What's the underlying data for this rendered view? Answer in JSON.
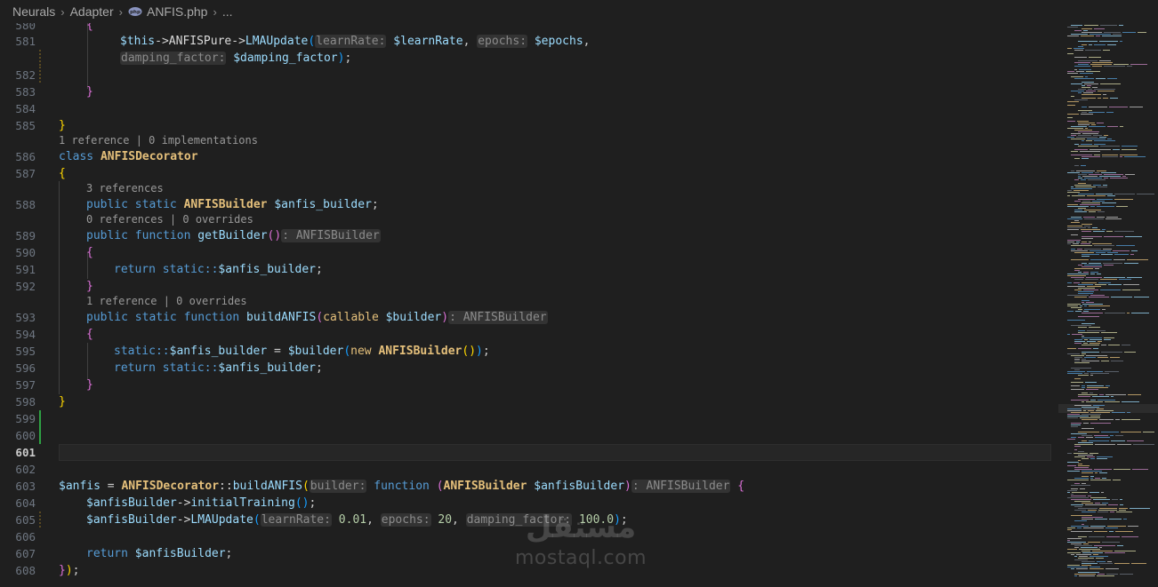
{
  "breadcrumb": {
    "items": [
      "Neurals",
      "Adapter",
      "ANFIS.php",
      "..."
    ]
  },
  "code_lens": {
    "l586": "1 reference | 0 implementations",
    "l588": "3 references",
    "l589": "0 references | 0 overrides",
    "l593": "1 reference | 0 overrides"
  },
  "line_numbers": [
    "580",
    "581",
    "",
    "582",
    "583",
    "584",
    "585",
    "",
    "586",
    "587",
    "",
    "588",
    "",
    "589",
    "590",
    "591",
    "592",
    "",
    "593",
    "594",
    "595",
    "596",
    "597",
    "598",
    "599",
    "600",
    "601",
    "602",
    "603",
    "604",
    "605",
    "606",
    "607",
    "608"
  ],
  "current_line": "601",
  "tokens": {
    "this": "$this",
    "arrow": "->",
    "anfisPure": "ANFISPure",
    "lmaUpdate": "LMAUpdate",
    "hint_learnRate": "learnRate:",
    "learnRate_var": "$learnRate",
    "hint_epochs": "epochs:",
    "epochs_var": "$epochs",
    "hint_damping": "damping_factor:",
    "damping_var": "$damping_factor",
    "class_kw": "class",
    "class_name": "ANFISDecorator",
    "public": "public",
    "static": "static",
    "function": "function",
    "return": "return",
    "new": "new",
    "callable": "callable",
    "builder_type": "ANFISBuilder",
    "anfis_builder_var": "$anfis_builder",
    "getBuilder": "getBuilder",
    "ret_type": ": ANFISBuilder",
    "static_ref": "static::",
    "buildANFIS": "buildANFIS",
    "builder_var": "$builder",
    "anfis_var": "$anfis",
    "hint_builder": "builder:",
    "anfisBuilder_var": "$anfisBuilder",
    "initialTraining": "initialTraining",
    "lr_val": "0.01",
    "ep_val": "20",
    "df_val": "100.0"
  },
  "watermark": {
    "arabic": "مستقل",
    "latin": "mostaql.com"
  },
  "colors": {
    "background": "#1f1f1f",
    "keyword": "#569cd6",
    "class": "#e5c07b",
    "function": "#dcdcaa",
    "variable": "#9cdcfe",
    "number": "#b5cea8"
  }
}
